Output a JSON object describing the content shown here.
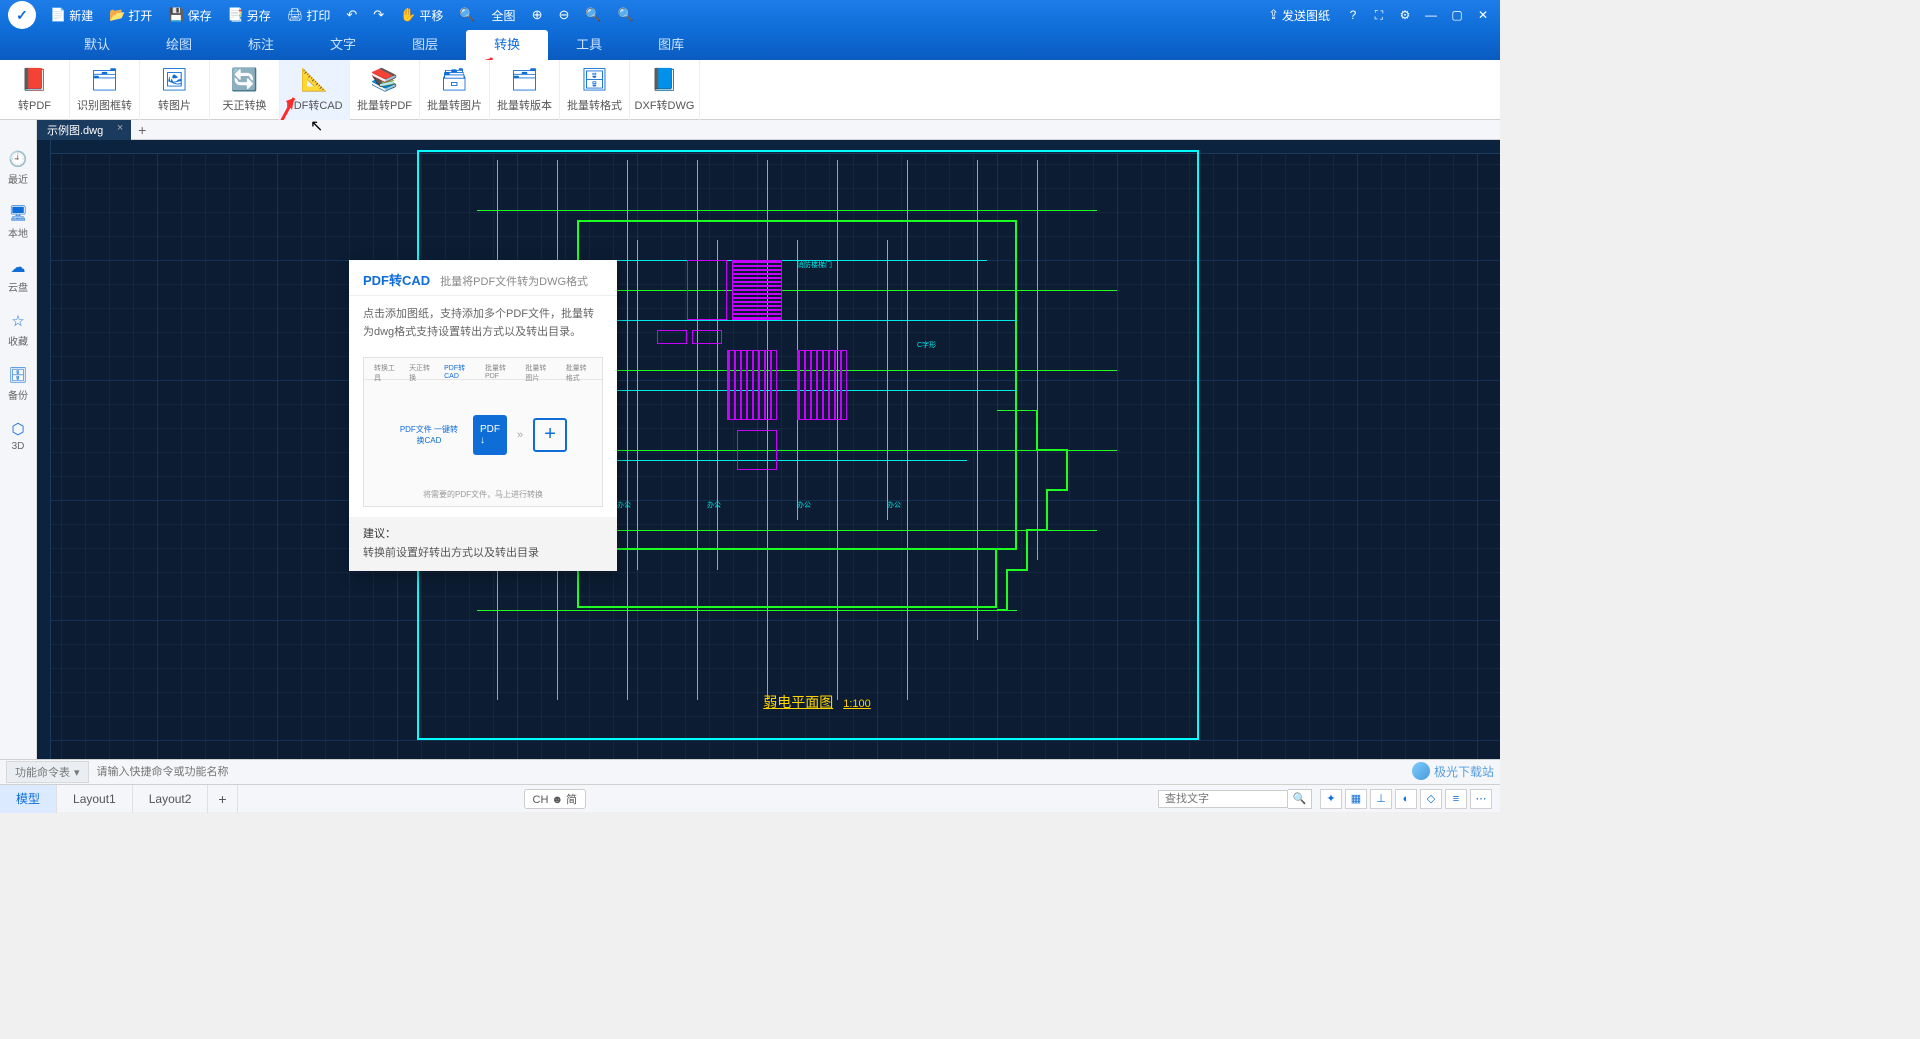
{
  "titlebar": {
    "buttons": {
      "new": "新建",
      "open": "打开",
      "save": "保存",
      "saveas": "另存",
      "print": "打印",
      "pan": "平移",
      "fit": "全图"
    },
    "right": {
      "send": "发送图纸"
    }
  },
  "menutabs": [
    "默认",
    "绘图",
    "标注",
    "文字",
    "图层",
    "转换",
    "工具",
    "图库"
  ],
  "menutabs_active": 5,
  "ribbon": [
    {
      "label": "转PDF"
    },
    {
      "label": "识别图框转"
    },
    {
      "label": "转图片"
    },
    {
      "label": "天正转换"
    },
    {
      "label": "PDF转CAD"
    },
    {
      "label": "批量转PDF"
    },
    {
      "label": "批量转图片"
    },
    {
      "label": "批量转版本"
    },
    {
      "label": "批量转格式"
    },
    {
      "label": "DXF转DWG"
    }
  ],
  "ribbon_active": 4,
  "sidebar": [
    {
      "icon": "🕘",
      "label": "最近"
    },
    {
      "icon": "🖥",
      "label": "本地"
    },
    {
      "icon": "☁",
      "label": "云盘"
    },
    {
      "icon": "☆",
      "label": "收藏"
    },
    {
      "icon": "🗄",
      "label": "备份"
    },
    {
      "icon": "⬡",
      "label": "3D"
    }
  ],
  "doc": {
    "name": "示例图.dwg"
  },
  "tooltip": {
    "title": "PDF转CAD",
    "subtitle": "批量将PDF文件转为DWG格式",
    "body": "点击添加图纸，支持添加多个PDF文件，批量转为dwg格式支持设置转出方式以及转出目录。",
    "pdfbox": "PDF文件\n一键转换CAD",
    "imgtabs": [
      "转换工具",
      "天正转换",
      "PDF转CAD",
      "批量转PDF",
      "批量转图片",
      "批量转格式"
    ],
    "caption": "将需要的PDF文件，马上进行转换",
    "advice_label": "建议：",
    "advice_text": "转换前设置好转出方式以及转出目录"
  },
  "cad": {
    "title": "弱电平面图",
    "scale": "1:100"
  },
  "cmdline": {
    "label": "功能命令表",
    "placeholder": "请输入快捷命令或功能名称"
  },
  "bottomtabs": [
    "模型",
    "Layout1",
    "Layout2"
  ],
  "bottomtabs_active": 0,
  "ime": "CH ☻ 简",
  "search": {
    "placeholder": "查找文字"
  },
  "watermark": "极光下载站"
}
